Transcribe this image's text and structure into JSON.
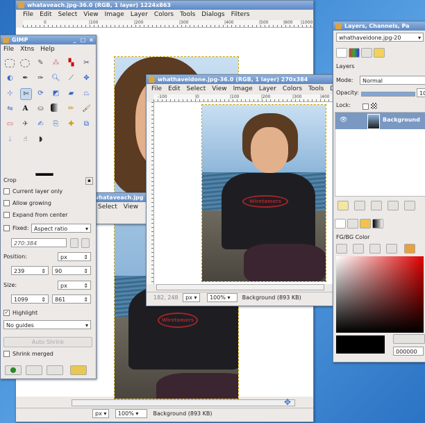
{
  "colors": {
    "titlebar": "#6f96cc",
    "desktop": "#3f8ad6",
    "fg": "#000000",
    "bg": "#ffffff"
  },
  "back_window": {
    "title": "whataveach.jpg-36.0 (RGB, 1 layer) 1224x863",
    "menu": [
      "File",
      "Edit",
      "Select",
      "View",
      "Image",
      "Layer",
      "Colors",
      "Tools",
      "Dialogs",
      "Filters"
    ],
    "ruler_labels": [
      "0",
      "|100",
      "|200",
      "|300",
      "|400",
      "|500",
      "|600",
      "|1000"
    ],
    "status": {
      "unit": "px",
      "zoom": "100%",
      "layer_info": "Background (893 KB)"
    }
  },
  "middle_window": {
    "title": "whataveach.jpg",
    "menu": [
      "Select",
      "View"
    ]
  },
  "front_window": {
    "title": "whathaveidone.jpg-36.0 (RGB, 1 layer) 270x384",
    "menu": [
      "File",
      "Edit",
      "Select",
      "View",
      "Image",
      "Layer",
      "Colors",
      "Tools",
      "Di"
    ],
    "ruler_labels": [
      "-100",
      "|0",
      "|100",
      "|200",
      "|300",
      "|400"
    ],
    "status": {
      "coords": "182, 248",
      "unit": "px",
      "zoom": "100%",
      "layer_info": "Background (893 KB)"
    }
  },
  "toolbox": {
    "title": "GIMP",
    "menu": [
      "File",
      "Xtns",
      "Help"
    ],
    "tool_options": {
      "tool_name": "Crop",
      "current_layer_only": "Current layer only",
      "allow_growing": "Allow growing",
      "expand_from_center": "Expand from center",
      "fixed_label": "Fixed:",
      "fixed_value": "Aspect ratio",
      "ratio": "270:384",
      "position_label": "Position:",
      "position_unit": "px",
      "position_x": "239",
      "position_y": "90",
      "size_label": "Size:",
      "size_unit": "px",
      "size_w": "1099",
      "size_h": "861",
      "highlight": "Highlight",
      "guides": "No guides",
      "auto_shrink": "Auto Shrink",
      "shrink_merged": "Shrink merged"
    }
  },
  "layers_dock": {
    "title": "Layers, Channels, Pa",
    "image_select": "whathaveidone.jpg-20",
    "panel_title": "Layers",
    "mode_label": "Mode:",
    "mode_value": "Normal",
    "opacity_label": "Opacity:",
    "opacity_value": "10",
    "opacity_fraction": 1.0,
    "lock_label": "Lock:",
    "layer_name": "Background",
    "fgbg_label": "FG/BG Color",
    "hex_value": "000000"
  },
  "photo_text": {
    "shirt_logo": "Wiretamers"
  }
}
